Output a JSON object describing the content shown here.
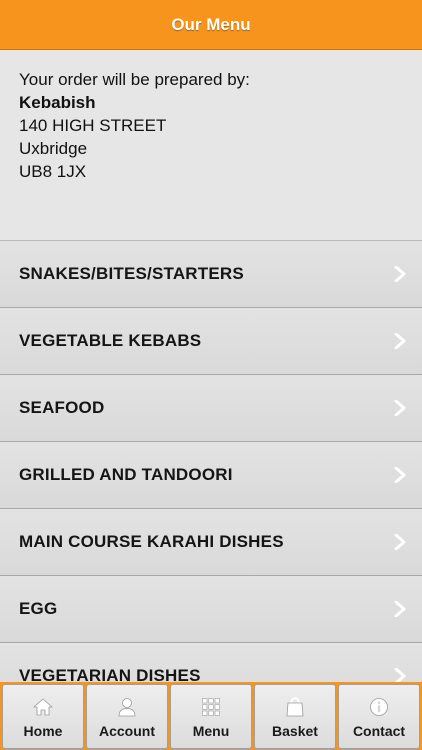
{
  "header": {
    "title": "Our Menu"
  },
  "restaurant": {
    "intro": "Your order will be prepared by:",
    "name": "Kebabish",
    "address_line1": "140 HIGH STREET",
    "city": "Uxbridge",
    "postcode": "UB8 1JX"
  },
  "menu": {
    "items": [
      {
        "label": "SNAKES/BITES/STARTERS"
      },
      {
        "label": "VEGETABLE KEBABS"
      },
      {
        "label": "SEAFOOD"
      },
      {
        "label": "GRILLED AND TANDOORI"
      },
      {
        "label": "MAIN COURSE KARAHI DISHES"
      },
      {
        "label": "EGG"
      },
      {
        "label": "VEGETARIAN DISHES"
      }
    ]
  },
  "tabs": [
    {
      "label": "Home",
      "icon": "home-icon"
    },
    {
      "label": "Account",
      "icon": "user-icon"
    },
    {
      "label": "Menu",
      "icon": "grid-icon"
    },
    {
      "label": "Basket",
      "icon": "bag-icon"
    },
    {
      "label": "Contact",
      "icon": "info-icon"
    }
  ],
  "colors": {
    "accent": "#f7941d",
    "background": "#e6e6e6",
    "icon": "#ffffff"
  }
}
